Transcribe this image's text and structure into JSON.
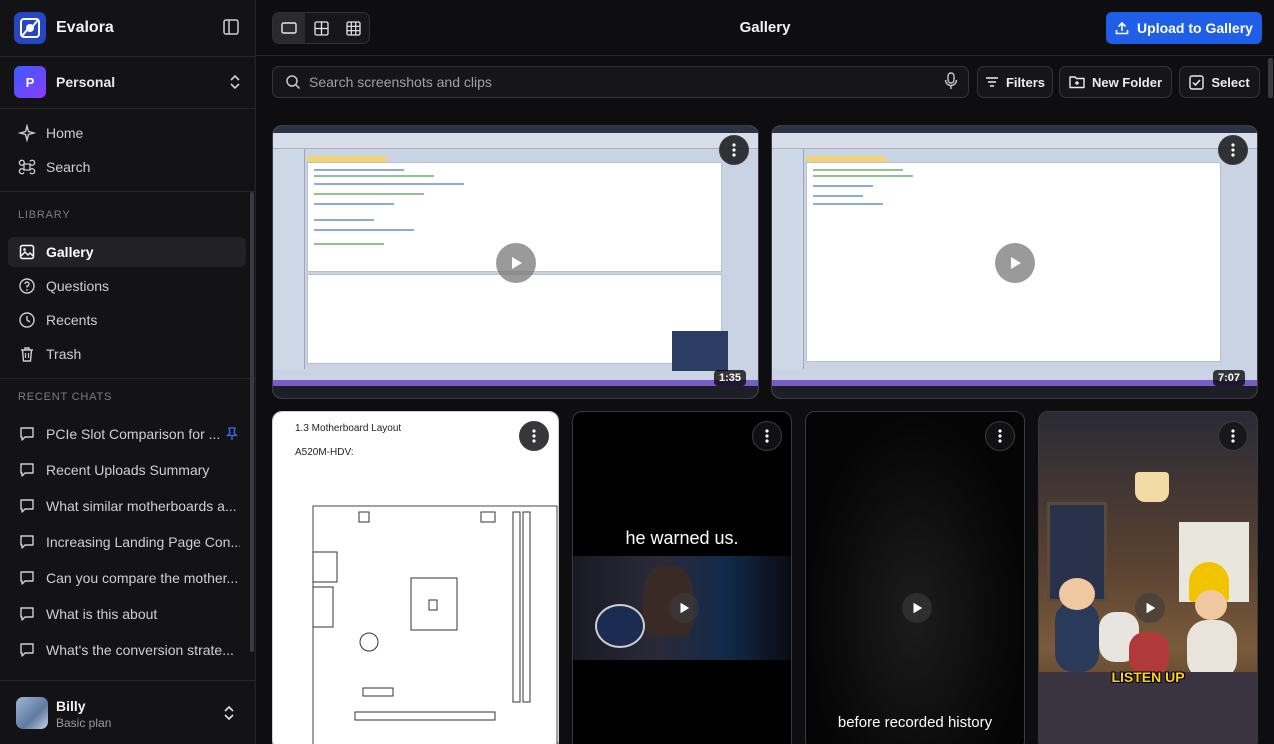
{
  "app": {
    "name": "Evalora"
  },
  "workspace": {
    "name": "Personal",
    "initial": "P"
  },
  "nav": {
    "home": "Home",
    "search": "Search"
  },
  "library": {
    "label": "LIBRARY",
    "items": [
      {
        "label": "Gallery",
        "active": true
      },
      {
        "label": "Questions"
      },
      {
        "label": "Recents"
      },
      {
        "label": "Trash"
      }
    ]
  },
  "recent_chats": {
    "label": "RECENT CHATS",
    "items": [
      {
        "label": "PCIe Slot Comparison for ...",
        "pinned": true
      },
      {
        "label": "Recent Uploads Summary"
      },
      {
        "label": "What similar motherboards a..."
      },
      {
        "label": "Increasing Landing Page Con..."
      },
      {
        "label": "Can you compare the mother..."
      },
      {
        "label": "What is this about"
      },
      {
        "label": "What's the conversion strate..."
      }
    ]
  },
  "user": {
    "name": "Billy",
    "plan": "Basic plan"
  },
  "header": {
    "title": "Gallery",
    "upload_label": "Upload to Gallery"
  },
  "toolbar": {
    "search_placeholder": "Search screenshots and clips",
    "filters_label": "Filters",
    "new_folder_label": "New Folder",
    "select_label": "Select"
  },
  "gallery": {
    "cards": [
      {
        "type": "video",
        "duration": "1:35"
      },
      {
        "type": "video",
        "duration": "7:07"
      },
      {
        "type": "document",
        "heading": "1.3 Motherboard Layout",
        "subheading": "A520M-HDV:"
      },
      {
        "type": "video",
        "caption": "he warned us."
      },
      {
        "type": "video",
        "caption": "before recorded history"
      },
      {
        "type": "video",
        "caption": "LISTEN UP"
      }
    ]
  },
  "colors": {
    "accent": "#1f5fe8",
    "sidebar_bg": "#131315",
    "page_bg": "#0e0e10"
  }
}
